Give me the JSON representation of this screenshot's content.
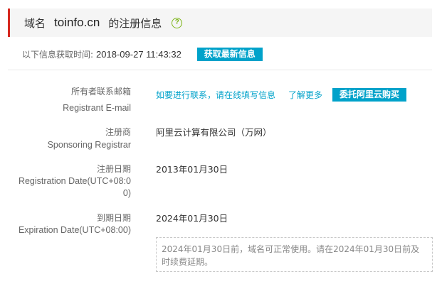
{
  "header": {
    "prefix": "域名",
    "domain": "toinfo.cn",
    "suffix": "的注册信息",
    "help_icon": "question-circle-icon"
  },
  "fetch": {
    "label": "以下信息获取时间:",
    "time": "2018-09-27 11:43:32",
    "button": "获取最新信息"
  },
  "rows": {
    "email": {
      "label_cn": "所有者联系邮箱",
      "label_en": "Registrant E-mail",
      "link_contact": "如要进行联系，请在线填写信息",
      "link_more": "了解更多",
      "button": "委托阿里云购买"
    },
    "registrar": {
      "label_cn": "注册商",
      "label_en": "Sponsoring Registrar",
      "value": "阿里云计算有限公司（万网）"
    },
    "registration": {
      "label_cn": "注册日期",
      "label_en_1": "Registration Date(UTC+08:0",
      "label_en_2": "0)",
      "value": "2013年01月30日"
    },
    "expiration": {
      "label_cn": "到期日期",
      "label_en": "Expiration Date(UTC+08:00)",
      "value": "2024年01月30日",
      "note": "2024年01月30日前，域名可正常使用。请在2024年01月30日前及时续费延期。"
    }
  },
  "colors": {
    "accent": "#00a2ca",
    "header_bar": "#d6281f",
    "help_icon": "#7cb518"
  }
}
